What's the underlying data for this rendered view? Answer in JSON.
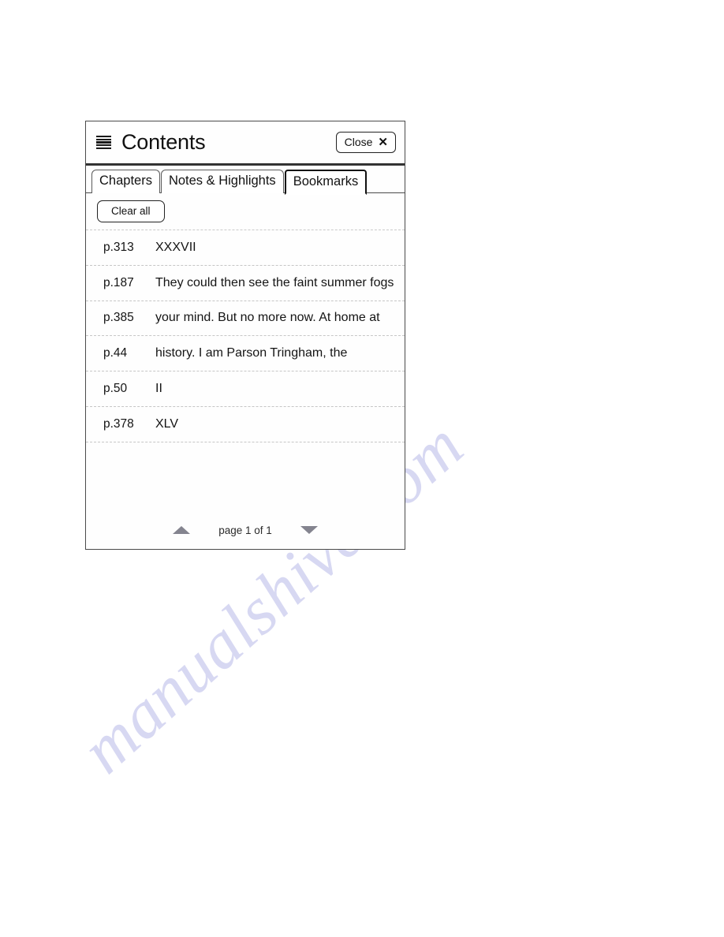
{
  "watermark": {
    "text": "manualshive.com",
    "color": "#d7d8f2"
  },
  "panel": {
    "header": {
      "icon": "list-icon",
      "title": "Contents",
      "close_label": "Close",
      "close_icon": "close-x-icon"
    },
    "tabs": [
      {
        "label": "Chapters",
        "active": false
      },
      {
        "label": "Notes & Highlights",
        "active": false
      },
      {
        "label": "Bookmarks",
        "active": true
      }
    ],
    "toolbar": {
      "clear_all_label": "Clear all"
    },
    "bookmarks": [
      {
        "page": "p.313",
        "text": "XXXVII"
      },
      {
        "page": "p.187",
        "text": "They could then see the faint summer fogs"
      },
      {
        "page": "p.385",
        "text": "your mind. But no more now. At home at"
      },
      {
        "page": "p.44",
        "text": "history. I am Parson Tringham, the"
      },
      {
        "page": "p.50",
        "text": "II"
      },
      {
        "page": "p.378",
        "text": "XLV"
      }
    ],
    "footer": {
      "page_indicator": "page 1 of 1",
      "up_arrow_icon": "triangle-up-icon",
      "down_arrow_icon": "triangle-down-icon"
    }
  }
}
